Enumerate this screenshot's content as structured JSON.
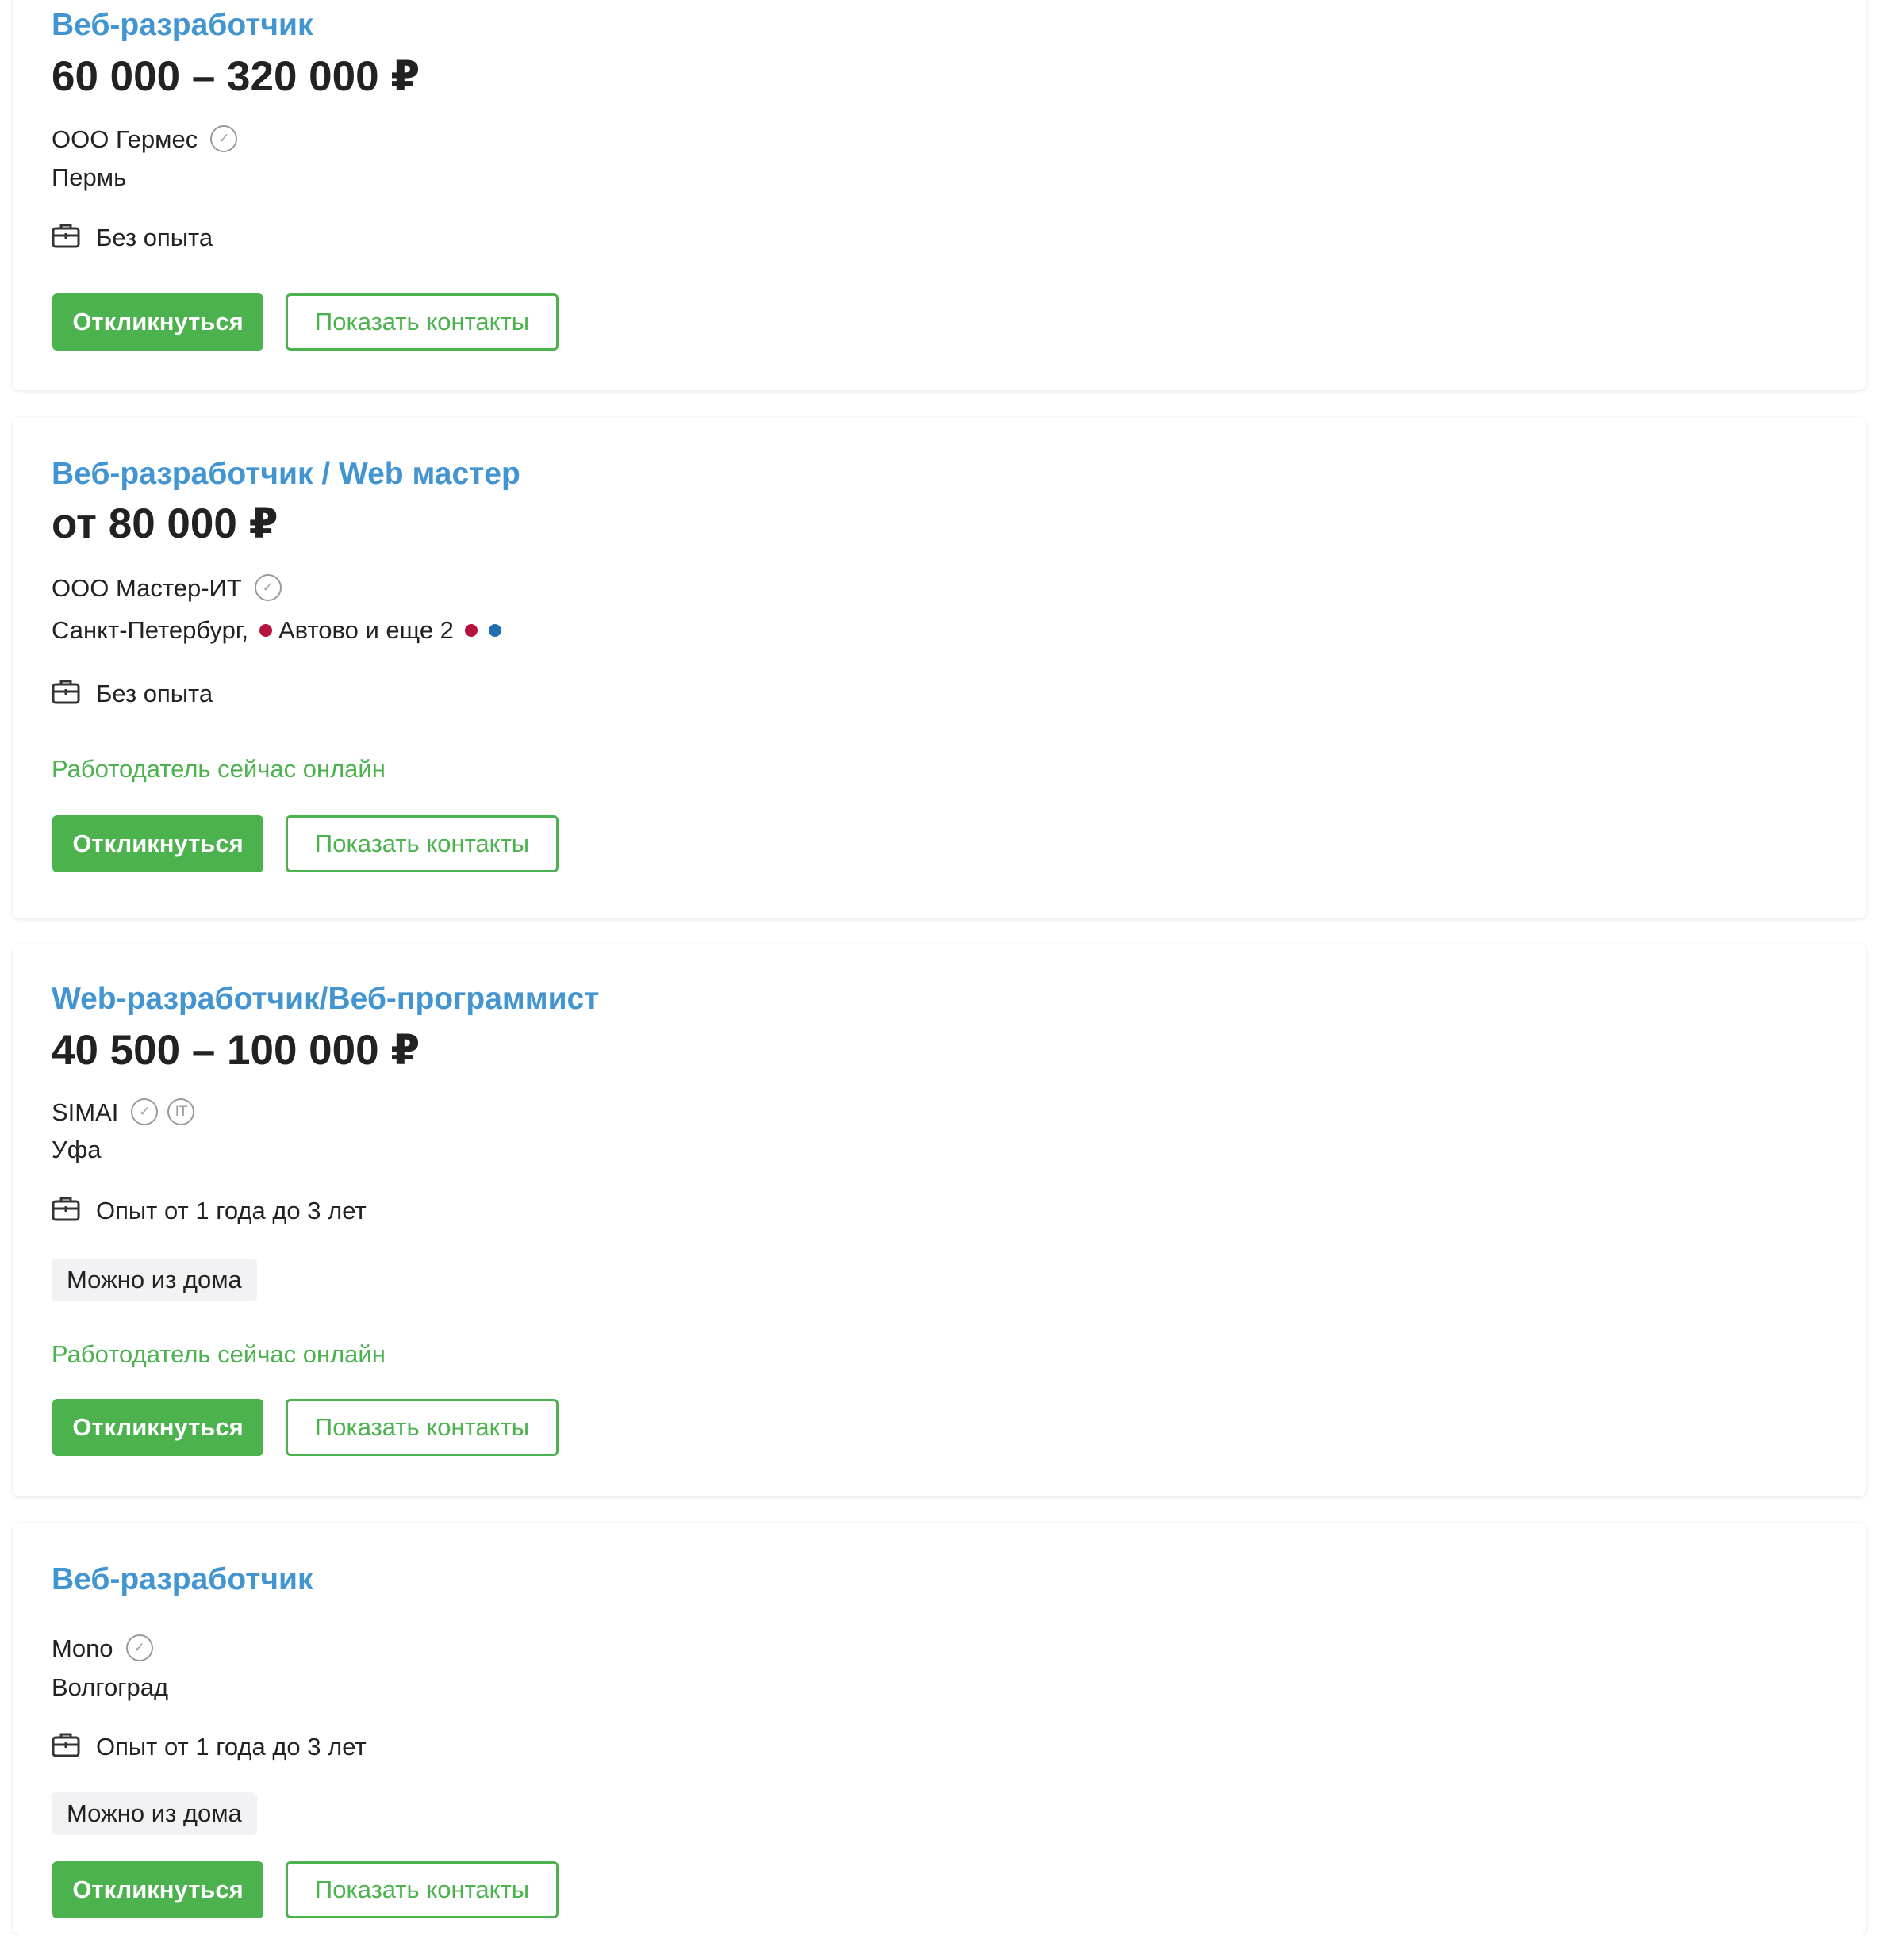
{
  "vacancies": [
    {
      "title": "Веб-разработчик",
      "salary": "60 000 – 320 000 ₽",
      "company": "ООО Гермес",
      "company_badges": [
        "verified-icon"
      ],
      "city": "Пермь",
      "experience": "Без опыта",
      "respond_label": "Откликнуться",
      "contacts_label": "Показать контакты"
    },
    {
      "title": "Веб-разработчик / Web мастер",
      "salary": "от 80 000 ₽",
      "company": "ООО Мастер-ИТ",
      "company_badges": [
        "verified-icon"
      ],
      "city": "Санкт-Петербург,",
      "metro": "Автово и еще 2",
      "metro_colors": [
        "#b5123c",
        "#b5123c",
        "#1f6fb2"
      ],
      "experience": "Без опыта",
      "online_status": "Работодатель сейчас онлайн",
      "respond_label": "Откликнуться",
      "contacts_label": "Показать контакты"
    },
    {
      "title": "Web-разработчик/Веб-программист",
      "salary": "40 500 – 100 000 ₽",
      "company": "SIMAI",
      "company_badges": [
        "verified-icon",
        "it-accredited-icon"
      ],
      "it_badge_text": "IT",
      "city": "Уфа",
      "experience": "Опыт от 1 года до 3 лет",
      "remote_tag": "Можно из дома",
      "online_status": "Работодатель сейчас онлайн",
      "respond_label": "Откликнуться",
      "contacts_label": "Показать контакты"
    },
    {
      "title": "Веб-разработчик",
      "company": "Mono",
      "company_badges": [
        "verified-icon"
      ],
      "city": "Волгоград",
      "experience": "Опыт от 1 года до 3 лет",
      "remote_tag": "Можно из дома",
      "respond_label": "Откликнуться",
      "contacts_label": "Показать контакты"
    }
  ],
  "colors": {
    "title_link": "#4295d1",
    "accent_green": "#4bb24e",
    "tag_background": "#f2f2f5",
    "badge_gray": "#9a9a9a"
  },
  "icons": {
    "verified": "check-in-circle",
    "experience": "briefcase"
  }
}
